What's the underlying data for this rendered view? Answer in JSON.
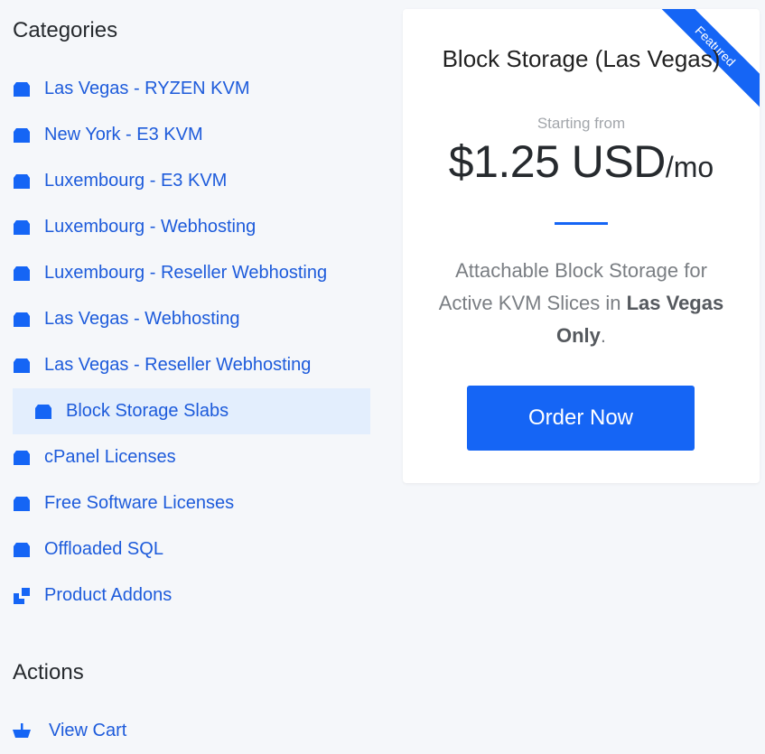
{
  "sidebar": {
    "categories_title": "Categories",
    "categories": [
      {
        "label": "Las Vegas - RYZEN KVM",
        "icon": "box-icon"
      },
      {
        "label": "New York - E3 KVM",
        "icon": "box-icon"
      },
      {
        "label": "Luxembourg - E3 KVM",
        "icon": "box-icon"
      },
      {
        "label": "Luxembourg - Webhosting",
        "icon": "box-icon"
      },
      {
        "label": "Luxembourg - Reseller Webhosting",
        "icon": "box-icon"
      },
      {
        "label": "Las Vegas - Webhosting",
        "icon": "box-icon"
      },
      {
        "label": "Las Vegas - Reseller Webhosting",
        "icon": "box-icon"
      },
      {
        "label": "Block Storage Slabs",
        "icon": "box-icon",
        "active": true
      },
      {
        "label": "cPanel Licenses",
        "icon": "box-icon"
      },
      {
        "label": "Free Software Licenses",
        "icon": "box-icon"
      },
      {
        "label": "Offloaded SQL",
        "icon": "box-icon"
      },
      {
        "label": "Product Addons",
        "icon": "addons-icon"
      }
    ],
    "actions_title": "Actions",
    "actions": [
      {
        "label": "View Cart",
        "icon": "cart-icon"
      }
    ]
  },
  "product": {
    "ribbon": "Featured",
    "title": "Block Storage (Las Vegas)",
    "starting_from": "Starting from",
    "price": "$1.25 USD",
    "period": "/mo",
    "description_pre": "Attachable Block Storage for Active KVM Slices in ",
    "description_bold": "Las Vegas Only",
    "description_post": ".",
    "order_label": "Order Now"
  },
  "colors": {
    "accent": "#1565f5",
    "link": "#1d5bdb",
    "active_bg": "#e3eefd",
    "page_bg": "#f5f7fa"
  }
}
